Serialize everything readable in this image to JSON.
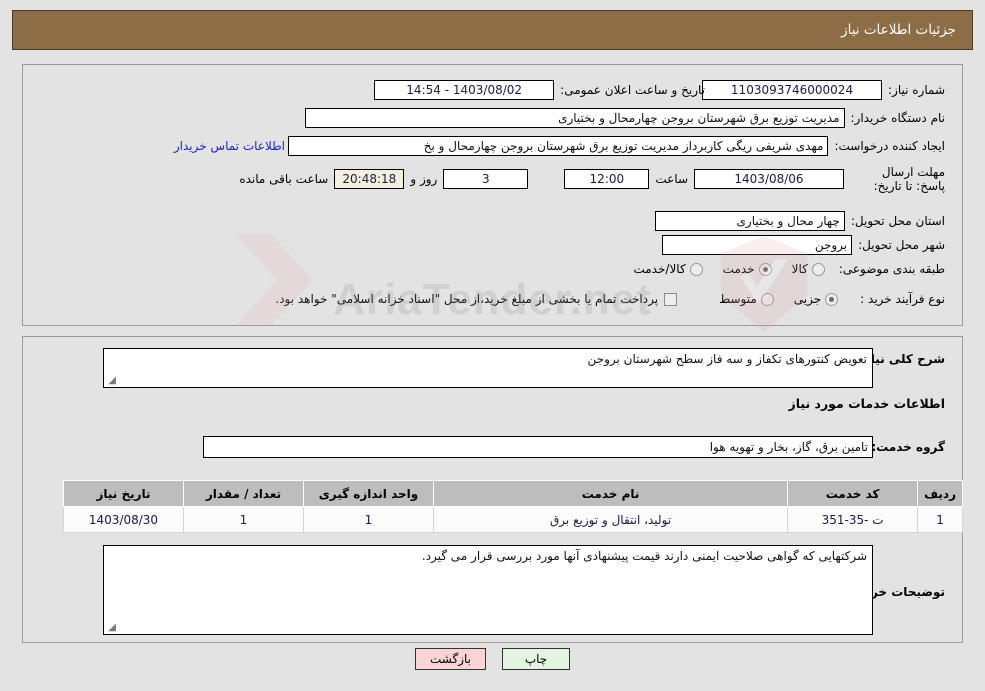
{
  "header": {
    "title": "جزئیات اطلاعات نیاز"
  },
  "watermark": {
    "text": "AriaTender.net"
  },
  "form": {
    "need_number_label": "شماره نیاز:",
    "need_number_value": "1103093746000024",
    "announce_datetime_label": "تاریخ و ساعت اعلان عمومی:",
    "announce_datetime_value": "1403/08/02 - 14:54",
    "buyer_org_label": "نام دستگاه خریدار:",
    "buyer_org_value": "مدیریت توزیع برق شهرستان بروجن چهارمحال و بختیاری",
    "creator_label": "ایجاد کننده درخواست:",
    "creator_value": "مهدی شریفی ریگی کاربرداز مدیریت توزیع برق شهرستان بروجن چهارمحال و بخ",
    "contact_link": "اطلاعات تماس خریدار",
    "deadline_label": "مهلت ارسال پاسخ: تا تاریخ:",
    "deadline_date": "1403/08/06",
    "deadline_time_label": "ساعت",
    "deadline_time": "12:00",
    "remaining_days": "3",
    "remaining_days_label": "روز و",
    "remaining_time": "20:48:18",
    "remaining_suffix": "ساعت باقی مانده",
    "province_label": "استان محل تحویل:",
    "province_value": "چهار محال و بختیاری",
    "city_label": "شهر محل تحویل:",
    "city_value": "بروجن",
    "category_label": "طبقه بندی موضوعی:",
    "category_options": [
      {
        "label": "کالا",
        "selected": false
      },
      {
        "label": "خدمت",
        "selected": true
      },
      {
        "label": "کالا/خدمت",
        "selected": false
      }
    ],
    "process_label": "نوع فرآیند خرید :",
    "process_options": [
      {
        "label": "جزیی",
        "selected": true
      },
      {
        "label": "متوسط",
        "selected": false
      }
    ],
    "treasury_checkbox_checked": false,
    "treasury_text": "پرداخت تمام یا بخشی از مبلغ خرید،از محل \"اسناد خزانه اسلامی\" خواهد بود."
  },
  "description": {
    "label": "شرح کلی نیاز:",
    "value": "تعویض کنتورهای تکفاز و سه فاز سطح شهرستان بروجن"
  },
  "services_section": {
    "heading": "اطلاعات خدمات مورد نیاز",
    "group_label": "گروه خدمت:",
    "group_value": "تامین برق، گاز، بخار و تهویه هوا"
  },
  "table": {
    "columns": [
      "ردیف",
      "کد خدمت",
      "نام خدمت",
      "واحد اندازه گیری",
      "تعداد / مقدار",
      "تاریخ نیاز"
    ],
    "rows": [
      {
        "row_no": "1",
        "service_code": "ت -35-351",
        "service_name": "تولید، انتقال و توزیع برق",
        "unit": "1",
        "quantity": "1",
        "need_date": "1403/08/30"
      }
    ]
  },
  "buyer_notes": {
    "label": "توضیحات خریدار:",
    "value": "شرکتهایی که گواهی صلاحیت ایمنی دارند قیمت پیشنهادی آنها مورد بررسی قرار می گیرد."
  },
  "footer": {
    "back_label": "بازگشت",
    "print_label": "چاپ"
  },
  "colors": {
    "header_bg": "#8c6d46",
    "page_bg": "#e3e3e3",
    "link": "#2222cc",
    "back_btn": "#f9d4d4",
    "print_btn": "#e3f5e0",
    "table_header": "#bdbdbd"
  }
}
